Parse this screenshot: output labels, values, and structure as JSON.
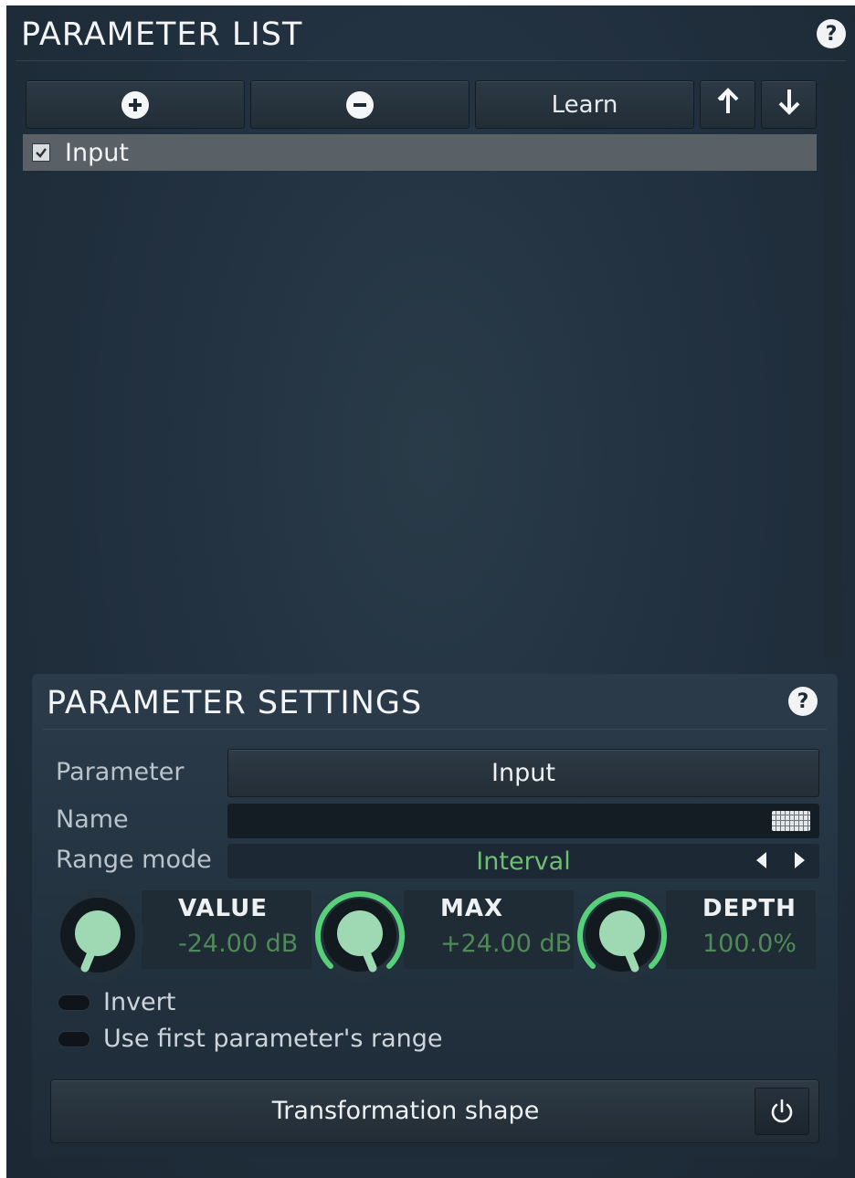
{
  "header": {
    "title": "PARAMETER LIST",
    "help_icon": "?"
  },
  "toolbar": {
    "add_icon": "plus-icon",
    "remove_icon": "minus-icon",
    "learn_label": "Learn",
    "up_icon": "arrow-up-icon",
    "down_icon": "arrow-down-icon"
  },
  "list": {
    "items": [
      {
        "label": "Input",
        "checked": true
      }
    ]
  },
  "settings": {
    "title": "PARAMETER SETTINGS",
    "help_icon": "?",
    "parameter_label": "Parameter",
    "parameter_value": "Input",
    "name_label": "Name",
    "name_value": "",
    "range_mode_label": "Range mode",
    "range_mode_value": "Interval",
    "knobs": [
      {
        "title": "VALUE",
        "value": "-24.00 dB"
      },
      {
        "title": "MAX",
        "value": "+24.00 dB"
      },
      {
        "title": "DEPTH",
        "value": "100.0%"
      }
    ],
    "invert_label": "Invert",
    "use_first_label": "Use first parameter's range",
    "transformation_label": "Transformation shape",
    "power_icon": "power-icon"
  },
  "colors": {
    "accent_green": "#6fbf73",
    "knob_ring": "#58d07a",
    "knob_face": "#9fd9b4",
    "background": "#223140"
  }
}
